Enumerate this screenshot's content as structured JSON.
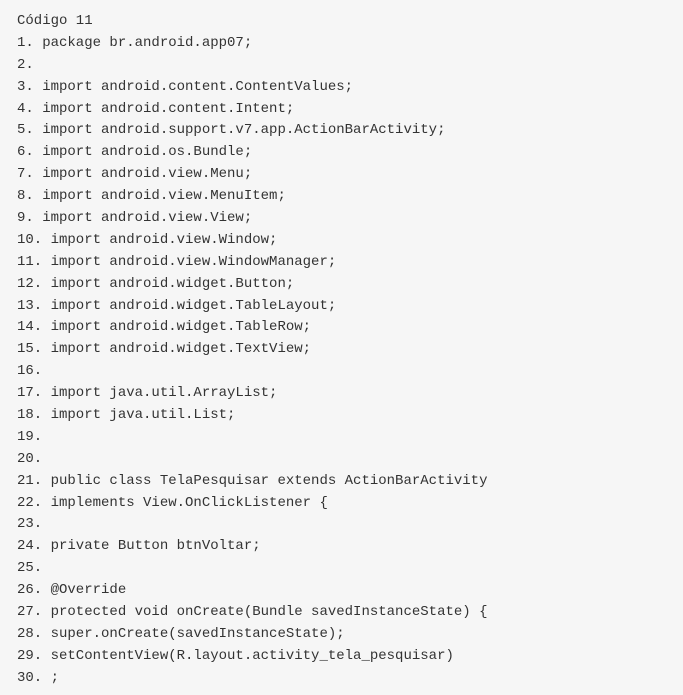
{
  "code_block": {
    "title": "Código 11",
    "lines": [
      "1. package br.android.app07;",
      "2.",
      "3. import android.content.ContentValues;",
      "4. import android.content.Intent;",
      "5. import android.support.v7.app.ActionBarActivity;",
      "6. import android.os.Bundle;",
      "7. import android.view.Menu;",
      "8. import android.view.MenuItem;",
      "9. import android.view.View;",
      "10. import android.view.Window;",
      "11. import android.view.WindowManager;",
      "12. import android.widget.Button;",
      "13. import android.widget.TableLayout;",
      "14. import android.widget.TableRow;",
      "15. import android.widget.TextView;",
      "16.",
      "17. import java.util.ArrayList;",
      "18. import java.util.List;",
      "19.",
      "20.",
      "21. public class TelaPesquisar extends ActionBarActivity",
      "22. implements View.OnClickListener {",
      "23.",
      "24. private Button btnVoltar;",
      "25.",
      "26. @Override",
      "27. protected void onCreate(Bundle savedInstanceState) {",
      "28. super.onCreate(savedInstanceState);",
      "29. setContentView(R.layout.activity_tela_pesquisar)",
      "30. ;"
    ]
  }
}
